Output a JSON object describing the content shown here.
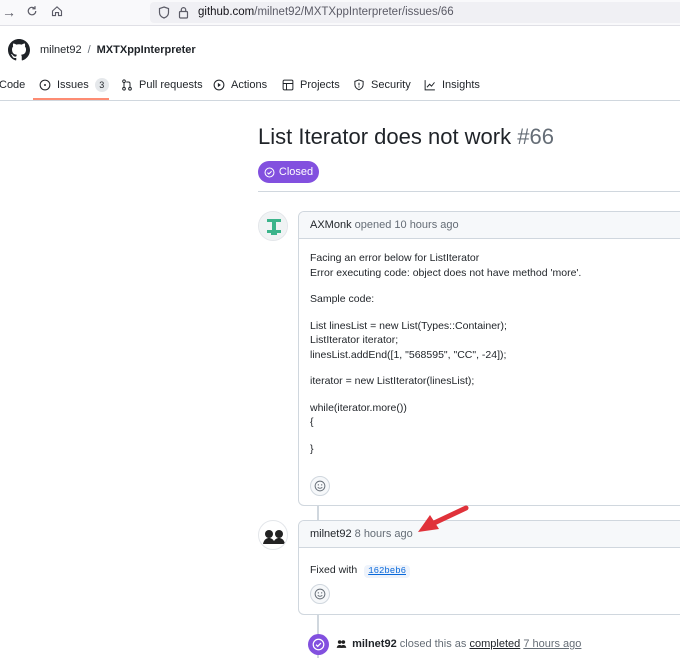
{
  "browser": {
    "url_host": "github.com",
    "url_path": "/milnet92/MXTXppInterpreter/issues/66"
  },
  "repo": {
    "owner": "milnet92",
    "name": "MXTXppInterpreter"
  },
  "tabs": [
    {
      "label": "Code",
      "icon": "code-icon"
    },
    {
      "label": "Issues",
      "icon": "issue-icon",
      "count": "3",
      "active": true
    },
    {
      "label": "Pull requests",
      "icon": "pull-request-icon"
    },
    {
      "label": "Actions",
      "icon": "play-icon"
    },
    {
      "label": "Projects",
      "icon": "table-icon"
    },
    {
      "label": "Security",
      "icon": "shield-icon"
    },
    {
      "label": "Insights",
      "icon": "graph-icon"
    }
  ],
  "issue": {
    "title": "List Iterator does not work",
    "number": "#66",
    "state": "Closed"
  },
  "comments": [
    {
      "author": "AXMonk",
      "meta": "opened 10 hours ago",
      "body": [
        [
          "Facing an error below for ListIterator",
          "Error executing code: object does not have method 'more'."
        ],
        [
          "Sample code:"
        ],
        [
          "List linesList = new List(Types::Container);",
          "ListIterator iterator;",
          "linesList.addEnd([1, \"568595\", \"CC\", -24]);"
        ],
        [
          "iterator = new ListIterator(linesList);"
        ],
        [
          "while(iterator.more())",
          "{"
        ],
        [
          "}"
        ]
      ]
    },
    {
      "author": "milnet92",
      "meta": "8 hours ago",
      "body_prefix": "Fixed with",
      "commit_sha": "162beb6"
    }
  ],
  "event": {
    "author": "milnet92",
    "text_before": "closed this as",
    "reason": "completed",
    "time": "7 hours ago"
  },
  "colors": {
    "accent_purple": "#8250df",
    "tab_underline": "#fd8c73",
    "annotation_arrow": "#e0323a"
  }
}
